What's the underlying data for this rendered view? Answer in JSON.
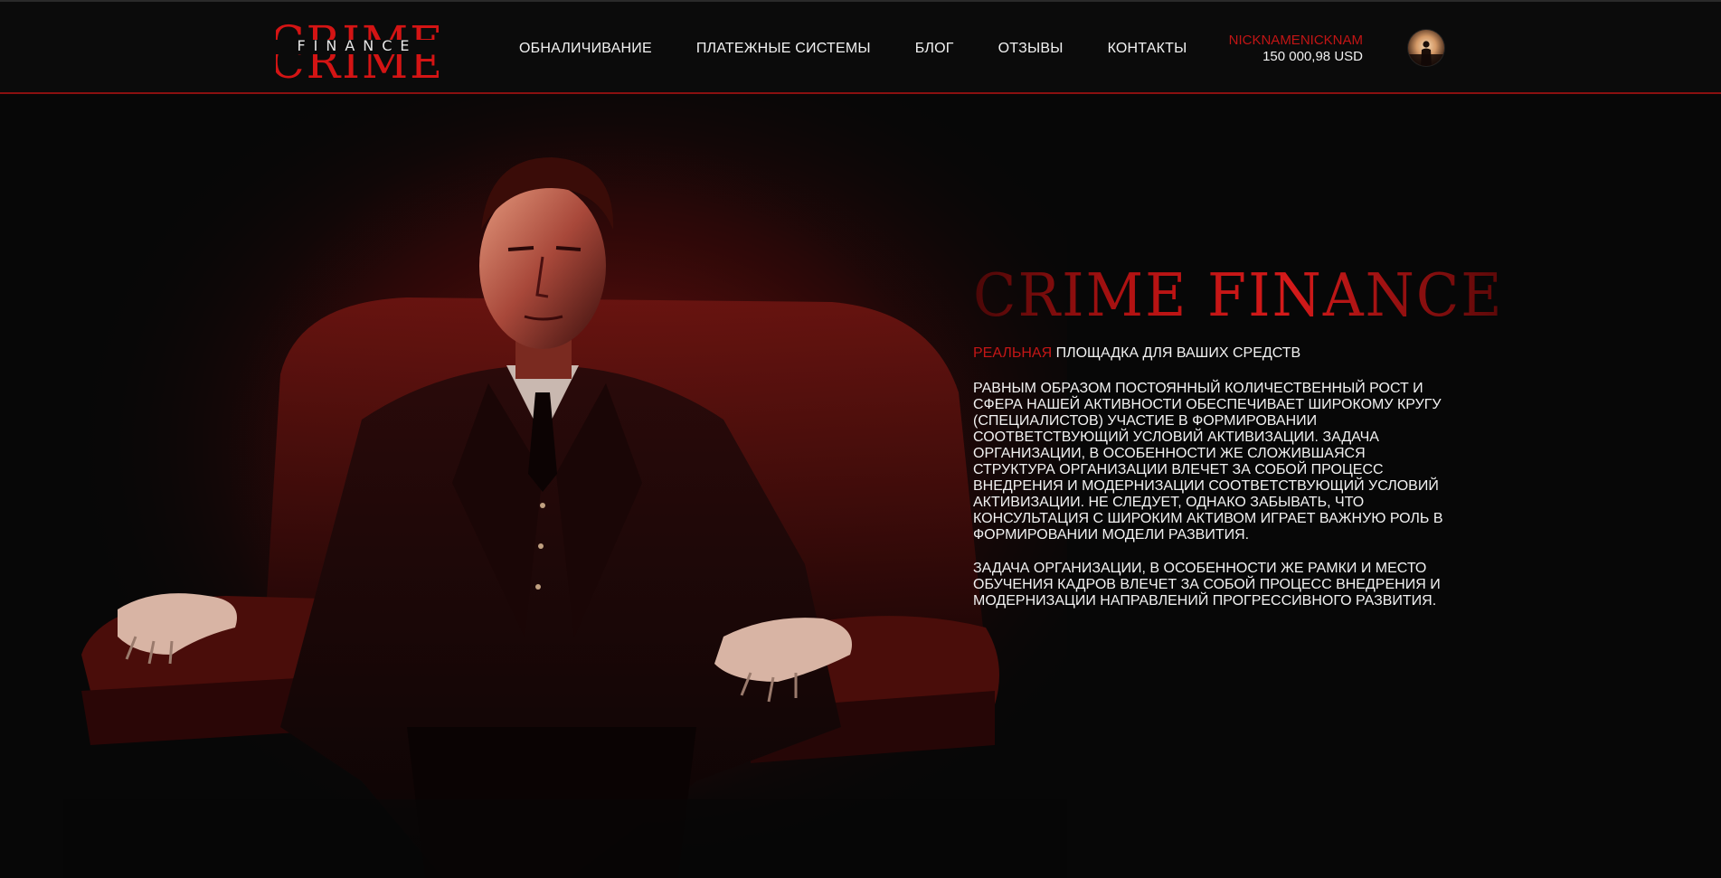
{
  "logo": {
    "top_word": "CRIME",
    "middle_word": "FINANCE",
    "bottom_word": "CRIME"
  },
  "nav": {
    "items": [
      {
        "label": "ОБНАЛИЧИВАНИЕ"
      },
      {
        "label": "ПЛАТЕЖНЫЕ СИСТЕМЫ"
      },
      {
        "label": "БЛОГ"
      },
      {
        "label": "ОТЗЫВЫ"
      },
      {
        "label": "КОНТАКТЫ"
      }
    ]
  },
  "user": {
    "nickname": "NICKNAMENICKNAM",
    "balance": "150 000,98 USD",
    "avatar_icon": "user-avatar-icon"
  },
  "hero": {
    "title": "CRIME FINANCE",
    "tagline_accent": "РЕАЛЬНАЯ",
    "tagline_rest": "ПЛОЩАДКА ДЛЯ ВАШИХ СРЕДСТВ",
    "paragraph_1": "РАВНЫМ ОБРАЗОМ ПОСТОЯННЫЙ КОЛИЧЕСТВЕННЫЙ РОСТ И СФЕРА НАШЕЙ АКТИВНОСТИ ОБЕСПЕЧИВАЕТ ШИРОКОМУ КРУГУ (СПЕЦИАЛИСТОВ) УЧАСТИЕ В ФОРМИРОВАНИИ СООТВЕТСТВУЮЩИЙ УСЛОВИЙ АКТИВИЗАЦИИ. ЗАДАЧА ОРГАНИЗАЦИИ, В ОСОБЕННОСТИ ЖЕ СЛОЖИВШАЯСЯ СТРУКТУРА ОРГАНИЗАЦИИ ВЛЕЧЕТ ЗА СОБОЙ ПРОЦЕСС ВНЕДРЕНИЯ И МОДЕРНИЗАЦИИ СООТВЕТСТВУЮЩИЙ УСЛОВИЙ АКТИВИЗАЦИИ. НЕ СЛЕДУЕТ, ОДНАКО ЗАБЫВАТЬ, ЧТО КОНСУЛЬТАЦИЯ С ШИРОКИМ АКТИВОМ ИГРАЕТ ВАЖНУЮ РОЛЬ В ФОРМИРОВАНИИ МОДЕЛИ РАЗВИТИЯ.",
    "paragraph_2": "ЗАДАЧА ОРГАНИЗАЦИИ, В ОСОБЕННОСТИ ЖЕ РАМКИ И МЕСТО ОБУЧЕНИЯ КАДРОВ ВЛЕЧЕТ ЗА СОБОЙ ПРОЦЕСС ВНЕДРЕНИЯ И МОДЕРНИЗАЦИИ НАПРАВЛЕНИЙ ПРОГРЕССИВНОГО РАЗВИТИЯ."
  },
  "colors": {
    "accent": "#c41616",
    "header_border": "#8a1010",
    "background": "#070707",
    "text": "#f2f2f2"
  }
}
